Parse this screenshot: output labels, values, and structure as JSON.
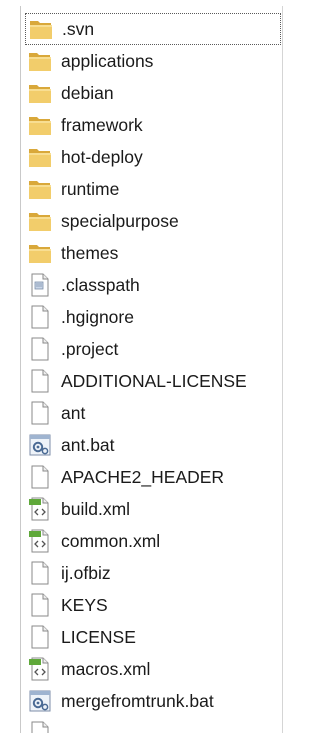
{
  "file_list": {
    "items": [
      {
        "name": ".svn",
        "icon": "folder-icon"
      },
      {
        "name": "applications",
        "icon": "folder-icon"
      },
      {
        "name": "debian",
        "icon": "folder-icon"
      },
      {
        "name": "framework",
        "icon": "folder-icon"
      },
      {
        "name": "hot-deploy",
        "icon": "folder-icon"
      },
      {
        "name": "runtime",
        "icon": "folder-icon"
      },
      {
        "name": "specialpurpose",
        "icon": "folder-icon"
      },
      {
        "name": "themes",
        "icon": "folder-icon"
      },
      {
        "name": ".classpath",
        "icon": "text-file-icon"
      },
      {
        "name": ".hgignore",
        "icon": "blank-file-icon"
      },
      {
        "name": ".project",
        "icon": "blank-file-icon"
      },
      {
        "name": "ADDITIONAL-LICENSE",
        "icon": "blank-file-icon"
      },
      {
        "name": "ant",
        "icon": "blank-file-icon"
      },
      {
        "name": "ant.bat",
        "icon": "batch-file-icon"
      },
      {
        "name": "APACHE2_HEADER",
        "icon": "blank-file-icon"
      },
      {
        "name": "build.xml",
        "icon": "xml-file-icon"
      },
      {
        "name": "common.xml",
        "icon": "xml-file-icon"
      },
      {
        "name": "ij.ofbiz",
        "icon": "blank-file-icon"
      },
      {
        "name": "KEYS",
        "icon": "blank-file-icon"
      },
      {
        "name": "LICENSE",
        "icon": "blank-file-icon"
      },
      {
        "name": "macros.xml",
        "icon": "xml-file-icon"
      },
      {
        "name": "mergefromtrunk.bat",
        "icon": "batch-file-icon"
      }
    ]
  }
}
